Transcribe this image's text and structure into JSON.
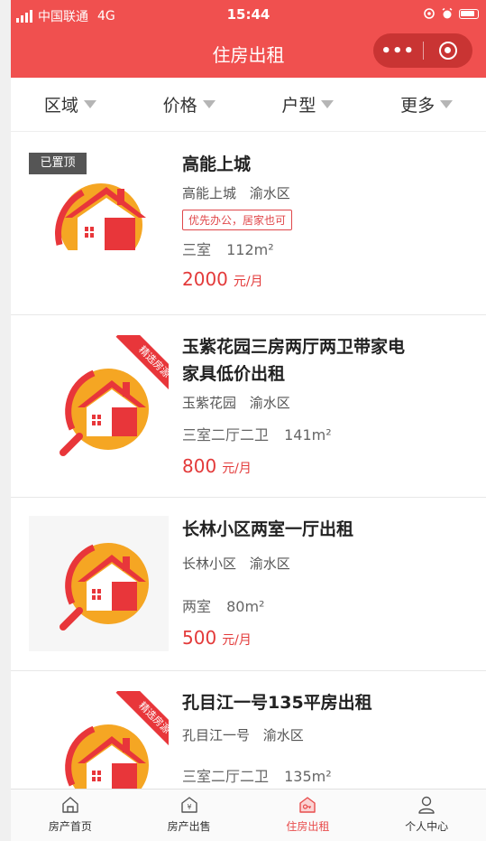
{
  "status_bar": {
    "carrier": "中国联通",
    "network": "4G",
    "time": "15:44"
  },
  "nav": {
    "title": "住房出租",
    "more_label": "•••",
    "brand_color": "#f0504f"
  },
  "filters": [
    {
      "label": "区域"
    },
    {
      "label": "价格"
    },
    {
      "label": "户型"
    },
    {
      "label": "更多"
    }
  ],
  "listings": [
    {
      "title_lines": [
        "高能上城"
      ],
      "community": "高能上城",
      "district": "渝水区",
      "tag": "优先办公，居家也可",
      "layout": "三室",
      "area": "112m²",
      "price": "2000",
      "price_unit": "元/月",
      "badge": "已置顶",
      "ribbon": "",
      "icon": "house-sun-icon"
    },
    {
      "title_lines": [
        "玉紫花园三房两厅两卫带家电",
        "家具低价出租"
      ],
      "community": "玉紫花园",
      "district": "渝水区",
      "tag": "",
      "layout": "三室二厅二卫",
      "area": "141m²",
      "price": "800",
      "price_unit": "元/月",
      "badge": "",
      "ribbon": "精选房源",
      "icon": "house-search-icon"
    },
    {
      "title_lines": [
        "长林小区两室一厅出租"
      ],
      "community": "长林小区",
      "district": "渝水区",
      "tag": "",
      "layout": "两室",
      "area": "80m²",
      "price": "500",
      "price_unit": "元/月",
      "badge": "",
      "ribbon": "",
      "icon": "house-search-icon"
    },
    {
      "title_lines": [
        "孔目江一号135平房出租"
      ],
      "community": "孔目江一号",
      "district": "渝水区",
      "tag": "",
      "layout": "三室二厅二卫",
      "area": "135m²",
      "price": "",
      "price_unit": "",
      "badge": "",
      "ribbon": "精选房源",
      "icon": "house-search-icon"
    }
  ],
  "tabbar": [
    {
      "label": "房产首页",
      "icon": "home-icon",
      "active": false
    },
    {
      "label": "房产出售",
      "icon": "sale-house-icon",
      "active": false
    },
    {
      "label": "住房出租",
      "icon": "rent-house-icon",
      "active": true
    },
    {
      "label": "个人中心",
      "icon": "user-icon",
      "active": false
    }
  ],
  "colors": {
    "accent": "#f0504f",
    "price": "#e33a3a",
    "house_red": "#e8363a",
    "sun_orange": "#f5a623"
  }
}
